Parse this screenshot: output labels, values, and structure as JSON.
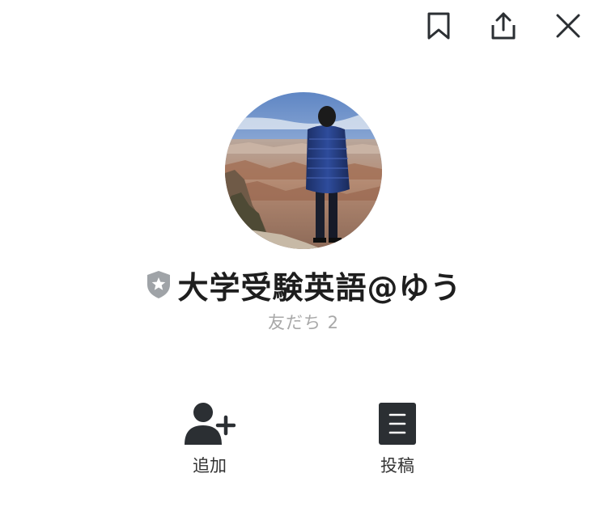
{
  "header": {
    "icons": {
      "bookmark": "bookmark-icon",
      "share": "share-icon",
      "close": "close-icon"
    }
  },
  "profile": {
    "name": "大学受験英語@ゆう",
    "friends": "友だち 2",
    "badge_icon": "shield-star-icon",
    "badge_color": "#9fa3a7"
  },
  "actions": [
    {
      "label": "追加",
      "icon": "add-friend-icon"
    },
    {
      "label": "投稿",
      "icon": "post-icon"
    }
  ],
  "colors": {
    "text": "#1e1e1e",
    "muted": "#a8a8a8",
    "icon": "#2b2f33"
  }
}
